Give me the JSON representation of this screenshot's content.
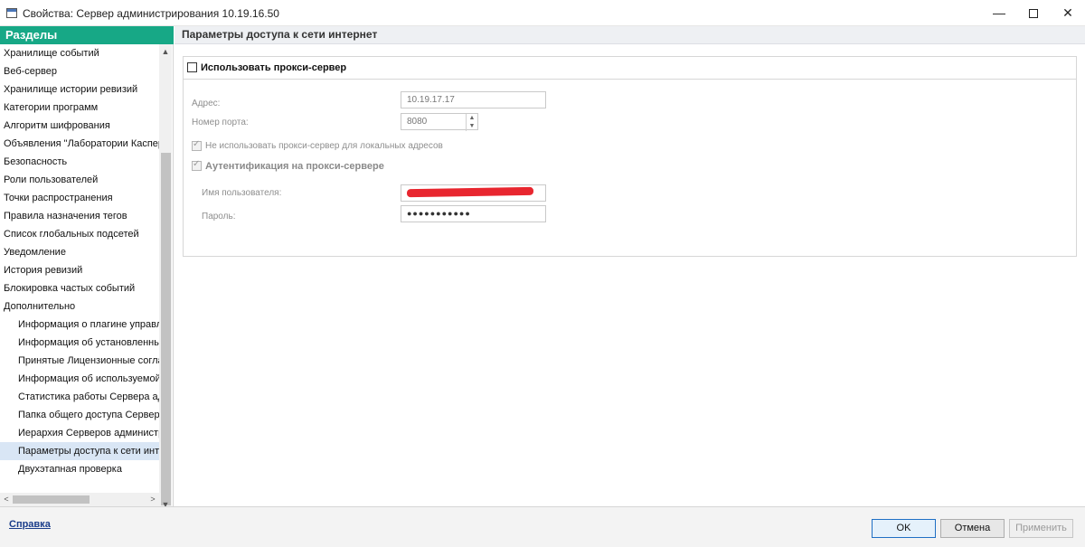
{
  "window": {
    "title": "Свойства: Сервер администрирования 10.19.16.50",
    "minimize": "—",
    "close": "✕"
  },
  "sidebar": {
    "header": "Разделы",
    "items": [
      {
        "label": "Хранилище событий",
        "level": 0
      },
      {
        "label": "Веб-сервер",
        "level": 0
      },
      {
        "label": "Хранилище истории ревизий",
        "level": 0
      },
      {
        "label": "Категории программ",
        "level": 0
      },
      {
        "label": "Алгоритм шифрования",
        "level": 0
      },
      {
        "label": "Объявления \"Лаборатории Касперского\"",
        "level": 0
      },
      {
        "label": "Безопасность",
        "level": 0
      },
      {
        "label": "Роли пользователей",
        "level": 0
      },
      {
        "label": "Точки распространения",
        "level": 0
      },
      {
        "label": "Правила назначения тегов",
        "level": 0
      },
      {
        "label": "Список глобальных подсетей",
        "level": 0
      },
      {
        "label": "Уведомление",
        "level": 0
      },
      {
        "label": "История ревизий",
        "level": 0
      },
      {
        "label": "Блокировка частых событий",
        "level": 0
      },
      {
        "label": "Дополнительно",
        "level": 0
      },
      {
        "label": "Информация о плагине управления С",
        "level": 1
      },
      {
        "label": "Информация об установленных плаги",
        "level": 1
      },
      {
        "label": "Принятые Лицензионные соглашения",
        "level": 1
      },
      {
        "label": "Информация об используемой базе д",
        "level": 1
      },
      {
        "label": "Статистика работы Сервера админи",
        "level": 1
      },
      {
        "label": "Папка общего доступа Сервера адми",
        "level": 1
      },
      {
        "label": "Иерархия Серверов администрирова",
        "level": 1
      },
      {
        "label": "Параметры доступа к сети интернет",
        "level": 1,
        "selected": true
      },
      {
        "label": "Двухэтапная проверка",
        "level": 1
      }
    ],
    "scroll_up": "▲",
    "scroll_down": "▼",
    "scroll_left": "<",
    "scroll_right": ">"
  },
  "content": {
    "title": "Параметры доступа к сети интернет",
    "use_proxy_label": "Использовать прокси-сервер",
    "use_proxy_checked": false,
    "address_label": "Адрес:",
    "address_value": "10.19.17.17",
    "port_label": "Номер порта:",
    "port_value": "8080",
    "no_local_label": "Не использовать прокси-сервер для локальных адресов",
    "no_local_checked": true,
    "auth_label": "Аутентификация на прокси-сервере",
    "auth_checked": true,
    "username_label": "Имя пользователя:",
    "password_label": "Пароль:",
    "password_value": "●●●●●●●●●●●"
  },
  "footer": {
    "help": "Справка",
    "ok": "OK",
    "cancel": "Отмена",
    "apply": "Применить"
  },
  "colors": {
    "accent": "#17a886",
    "selection": "#d9e6f5",
    "redaction": "#e8262f"
  }
}
